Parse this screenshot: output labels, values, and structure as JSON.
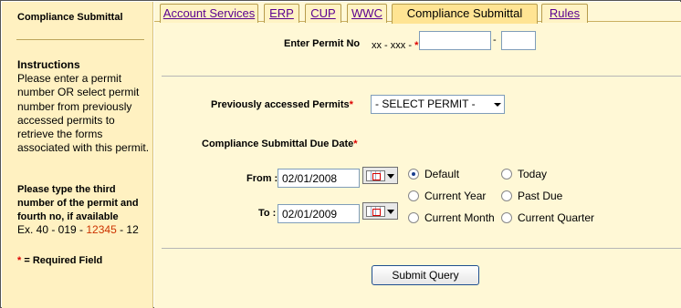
{
  "sidebar": {
    "title": "Compliance Submittal",
    "instructions_heading": "Instructions",
    "instructions_text": "Please enter a permit number OR select permit number from previously accessed permits to retrieve the forms associated with this permit.",
    "hint_text": "Please type the third number of the permit and fourth no, if available",
    "example_prefix": "Ex. 40 - 019 - ",
    "example_highlight": "12345",
    "example_suffix": " - 12",
    "required_star": "*",
    "required_text": " = Required Field"
  },
  "tabs": [
    {
      "label": "Account Services"
    },
    {
      "label": "ERP"
    },
    {
      "label": "CUP"
    },
    {
      "label": "WWC"
    },
    {
      "label": "Compliance Submittal",
      "active": true
    },
    {
      "label": "Rules"
    }
  ],
  "permit": {
    "label": "Enter Permit No",
    "format": "xx - xxx -",
    "required_star": "*",
    "main_value": "",
    "separator": "-",
    "suffix_value": ""
  },
  "previous": {
    "label": "Previously accessed Permits",
    "required_star": "*",
    "selected": "- SELECT PERMIT -"
  },
  "due_date": {
    "label": "Compliance Submittal Due Date",
    "required_star": "*",
    "from_label": "From :",
    "from_value": "02/01/2008",
    "to_label": "To :",
    "to_value": "02/01/2009"
  },
  "radios": [
    {
      "label": "Default",
      "checked": true
    },
    {
      "label": "Today",
      "checked": false
    },
    {
      "label": "Current Year",
      "checked": false
    },
    {
      "label": "Past Due",
      "checked": false
    },
    {
      "label": "Current Month",
      "checked": false
    },
    {
      "label": "Current Quarter",
      "checked": false
    }
  ],
  "submit_label": "Submit Query",
  "icons": {
    "calendar": "calendar-icon",
    "dropdown": "chevron-down-icon"
  },
  "colors": {
    "sidebar_bg": "#fff1c1",
    "main_bg": "#fff8d6",
    "active_tab": "#ffe493",
    "tab_link": "#5a0090",
    "required": "#dd0000",
    "highlight": "#cc3300"
  }
}
